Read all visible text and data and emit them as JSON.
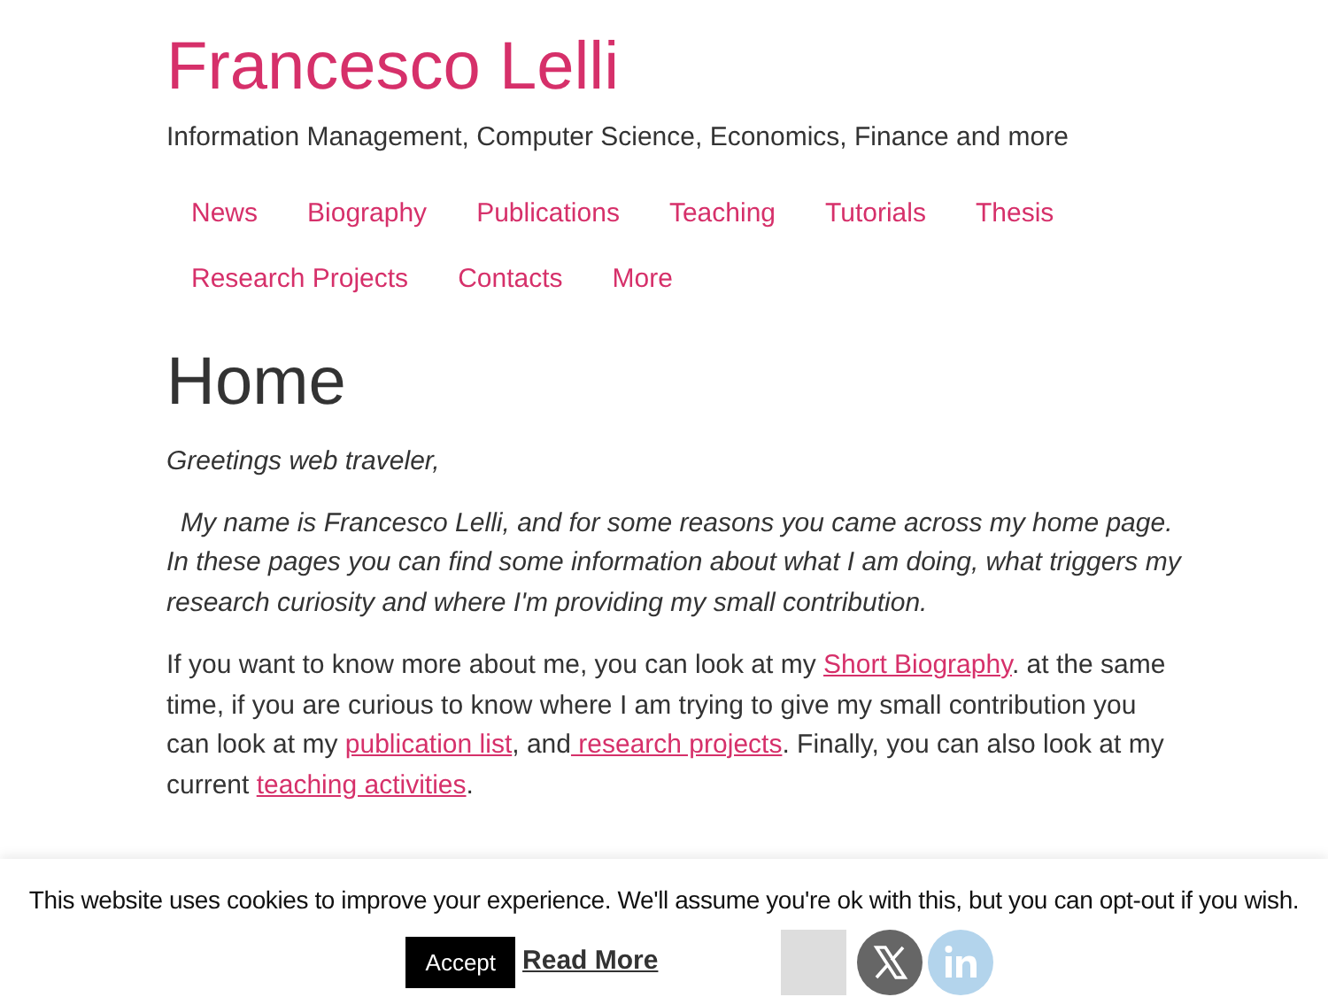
{
  "site": {
    "title": "Francesco Lelli",
    "tagline": "Information Management, Computer Science, Economics, Finance and more"
  },
  "nav": [
    "News",
    "Biography",
    "Publications",
    "Teaching",
    "Tutorials",
    "Thesis",
    "Research Projects",
    "Contacts",
    "More"
  ],
  "page_title": "Home",
  "greeting": "Greetings web traveler,",
  "intro": "My name is Francesco Lelli, and for some reasons you came across my home page. In these pages you can find some information about what I am doing, what triggers my research curiosity and where I'm providing my small contribution.",
  "body": [
    {
      "kind": "text",
      "text": "If you want to know more about me, you can look at my "
    },
    {
      "kind": "link",
      "text": "Short Biography"
    },
    {
      "kind": "text",
      "text": ". at the same time, if you are curious to know where I am trying to give my small contribution you can look at my "
    },
    {
      "kind": "link",
      "text": "publication list"
    },
    {
      "kind": "text",
      "text": ", and"
    },
    {
      "kind": "link",
      "text": " research projects"
    },
    {
      "kind": "text",
      "text": ". Finally, you can also look at my current "
    },
    {
      "kind": "link",
      "text": "teaching activities"
    },
    {
      "kind": "text",
      "text": "."
    }
  ],
  "cookie_bar": {
    "message": "This website uses cookies to improve your experience. We'll assume you're ok with this, but you can opt-out if you wish.",
    "accept": "Accept",
    "read_more": "Read More"
  }
}
